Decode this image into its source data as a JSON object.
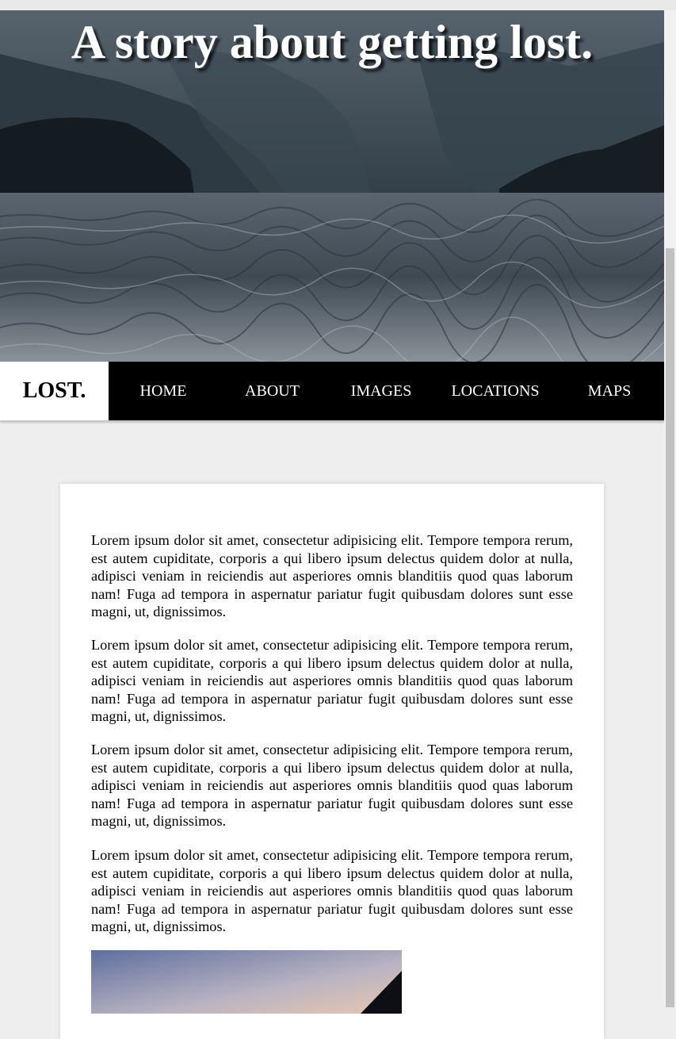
{
  "hero": {
    "title": "A story about getting lost."
  },
  "navbar": {
    "brand": "LOST.",
    "items": [
      {
        "label": "HOME"
      },
      {
        "label": "ABOUT"
      },
      {
        "label": "IMAGES"
      },
      {
        "label": "LOCATIONS"
      },
      {
        "label": "MAPS"
      }
    ]
  },
  "content": {
    "paragraphs": [
      "Lorem ipsum dolor sit amet, consectetur adipisicing elit. Tempore tempora rerum, est autem cupiditate, corporis a qui libero ipsum delectus quidem dolor at nulla, adipisci veniam in reiciendis aut asperiores omnis blanditiis quod quas laborum nam! Fuga ad tempora in aspernatur pariatur fugit quibusdam dolores sunt esse magni, ut, dignissimos.",
      "Lorem ipsum dolor sit amet, consectetur adipisicing elit. Tempore tempora rerum, est autem cupiditate, corporis a qui libero ipsum delectus quidem dolor at nulla, adipisci veniam in reiciendis aut asperiores omnis blanditiis quod quas laborum nam! Fuga ad tempora in aspernatur pariatur fugit quibusdam dolores sunt esse magni, ut, dignissimos.",
      "Lorem ipsum dolor sit amet, consectetur adipisicing elit. Tempore tempora rerum, est autem cupiditate, corporis a qui libero ipsum delectus quidem dolor at nulla, adipisci veniam in reiciendis aut asperiores omnis blanditiis quod quas laborum nam! Fuga ad tempora in aspernatur pariatur fugit quibusdam dolores sunt esse magni, ut, dignissimos.",
      "Lorem ipsum dolor sit amet, consectetur adipisicing elit. Tempore tempora rerum, est autem cupiditate, corporis a qui libero ipsum delectus quidem dolor at nulla, adipisci veniam in reiciendis aut asperiores omnis blanditiis quod quas laborum nam! Fuga ad tempora in aspernatur pariatur fugit quibusdam dolores sunt esse magni, ut, dignissimos."
    ]
  },
  "colors": {
    "page_background": "#eeeeee",
    "navbar_background": "#000000",
    "brand_background": "#ffffff",
    "card_background": "#ffffff"
  }
}
